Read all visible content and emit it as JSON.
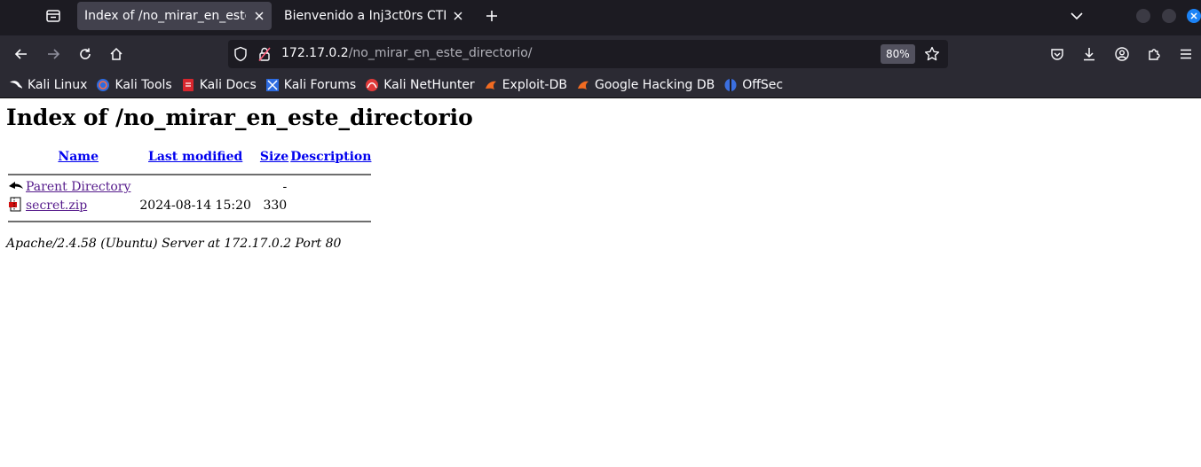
{
  "tabs": [
    {
      "title": "Index of /no_mirar_en_este_d",
      "active": true
    },
    {
      "title": "Bienvenido a Inj3ct0rs CTF",
      "active": false
    }
  ],
  "urlbar": {
    "host": "172.17.0.2",
    "path": "/no_mirar_en_este_directorio/",
    "zoom": "80%"
  },
  "bookmarks": [
    {
      "label": "Kali Linux",
      "icon": "kali-dragon-icon"
    },
    {
      "label": "Kali Tools",
      "icon": "kali-tools-icon"
    },
    {
      "label": "Kali Docs",
      "icon": "kali-docs-icon"
    },
    {
      "label": "Kali Forums",
      "icon": "kali-forums-icon"
    },
    {
      "label": "Kali NetHunter",
      "icon": "kali-nethunter-icon"
    },
    {
      "label": "Exploit-DB",
      "icon": "exploit-db-icon"
    },
    {
      "label": "Google Hacking DB",
      "icon": "ghdb-icon"
    },
    {
      "label": "OffSec",
      "icon": "offsec-icon"
    }
  ],
  "page": {
    "heading": "Index of /no_mirar_en_este_directorio",
    "columns": {
      "name": "Name",
      "last_modified": "Last modified",
      "size": "Size",
      "description": "Description"
    },
    "rows": [
      {
        "name": "Parent Directory",
        "modified": "",
        "size": "-",
        "description": "",
        "icon": "back-icon"
      },
      {
        "name": "secret.zip",
        "modified": "2024-08-14 15:20",
        "size": "330",
        "description": "",
        "icon": "compressed-file-icon"
      }
    ],
    "footer": "Apache/2.4.58 (Ubuntu) Server at 172.17.0.2 Port 80"
  },
  "colors": {
    "tabstrip": "#1c1b22",
    "toolbar": "#2b2a33",
    "link": "#0000ee",
    "visited_link": "#551a8b",
    "close_accent": "#1c83f6"
  }
}
